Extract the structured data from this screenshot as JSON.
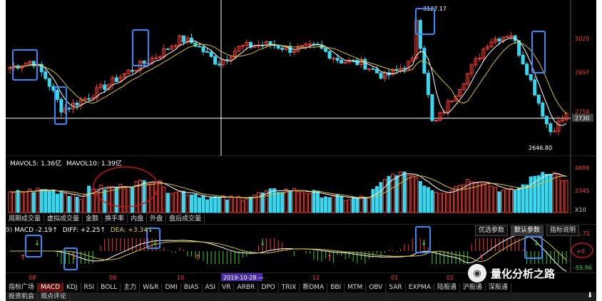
{
  "colors": {
    "up": "#ff3b30",
    "down": "#3ad8f0",
    "ma5": "#ffffff",
    "ma10": "#d9c02a",
    "highlight": "#2f8cff",
    "circle": "#c21515",
    "cross": "#ffffff",
    "date_tag": "#4b2aa6"
  },
  "kline": {
    "price_labels": [
      "3020",
      "2897",
      "2754",
      "2730"
    ],
    "annotations": {
      "high": "3127.17",
      "low": "2646.80"
    },
    "price_range": [
      2620,
      3140
    ],
    "candles_count": 142
  },
  "volume": {
    "indicator_line": {
      "mavol5_label": "MAVOL5:",
      "mavol5_value": "1.36亿",
      "mavol10_label": "MAVOL10:",
      "mavol10_value": "1.39亿"
    },
    "axis": [
      "4690",
      "2345",
      "X10"
    ]
  },
  "vol_tabs": [
    "周期成交量",
    "虚拟成交量",
    "金额",
    "换手率",
    "内盘",
    "外盘",
    "盘后成交量"
  ],
  "macd": {
    "indicator_line": {
      "prefix": "9)",
      "macd_label": "MACD",
      "macd_value": "-2.19↑",
      "diff_label": "DIFF:",
      "diff_value": "+2.25↑",
      "dea_label": "DEA:",
      "dea_value": "+3.34↓"
    },
    "axis": {
      "top": "41.71",
      "zero": "+0",
      "bottom": "-59.96"
    },
    "buttons": [
      "优选参数",
      "默认参数",
      "指标说明"
    ],
    "active_button": "默认参数"
  },
  "date_axis": {
    "labels": [
      "08",
      "09",
      "10",
      "11",
      "12",
      "01",
      "02"
    ],
    "cursor_date": "2019-10-28 —"
  },
  "indicator_tabs": [
    "指标广场",
    "MACD",
    "KDJ",
    "RSI",
    "BOLL",
    "主力",
    "W&R",
    "DMI",
    "BIAS",
    "ASI",
    "VR",
    "ARBR",
    "DPO",
    "TRIX",
    "新DMA",
    "BBI",
    "MTM",
    "OBV",
    "SAR",
    "EXPMA",
    "陆股通",
    "沪股通",
    "深股通"
  ],
  "active_indicator": "MACD",
  "bottom_tabs": [
    "投资机会",
    "观点评论"
  ],
  "watermark": "量化分析之路",
  "icons": {
    "wechat": "wechat-icon",
    "download": "download-arrow-icon"
  }
}
